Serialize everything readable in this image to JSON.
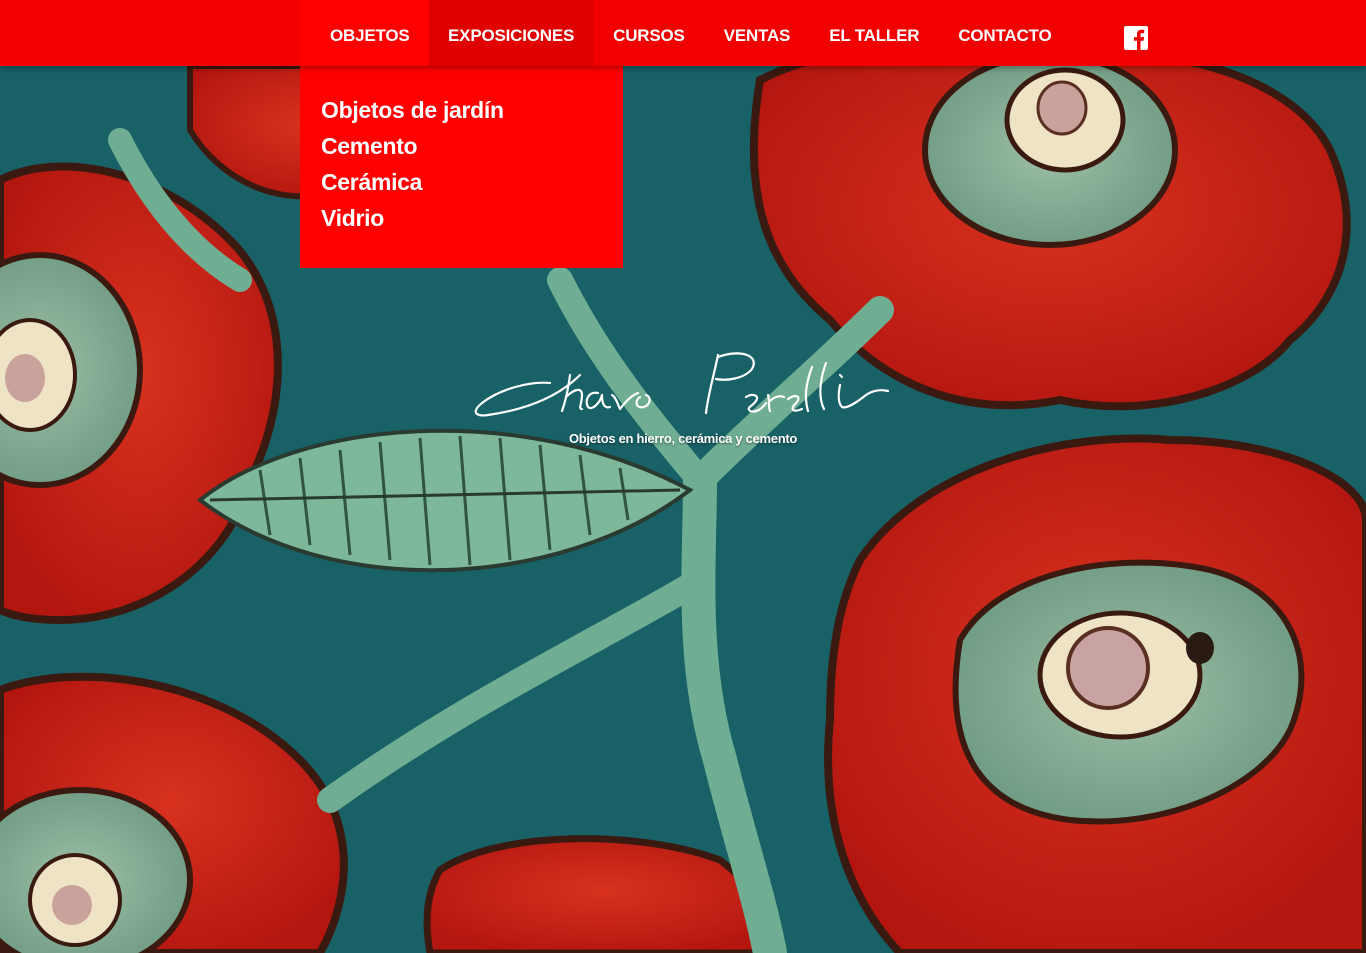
{
  "nav": {
    "items": [
      {
        "label": "OBJETOS"
      },
      {
        "label": "EXPOSICIONES"
      },
      {
        "label": "CURSOS"
      },
      {
        "label": "VENTAS"
      },
      {
        "label": "EL TALLER"
      },
      {
        "label": "CONTACTO"
      }
    ],
    "social_icon": "facebook-icon"
  },
  "dropdown": {
    "items": [
      {
        "label": "Objetos de jardín"
      },
      {
        "label": "Cemento"
      },
      {
        "label": "Cerámica"
      },
      {
        "label": "Vidrio"
      }
    ]
  },
  "hero": {
    "logo_signature": "Charo Perelli",
    "tagline": "Objetos en hierro, cerámica y cemento"
  },
  "colors": {
    "nav_background": "#f20000",
    "dropdown_background": "#ff0000",
    "text": "#ffffff"
  }
}
